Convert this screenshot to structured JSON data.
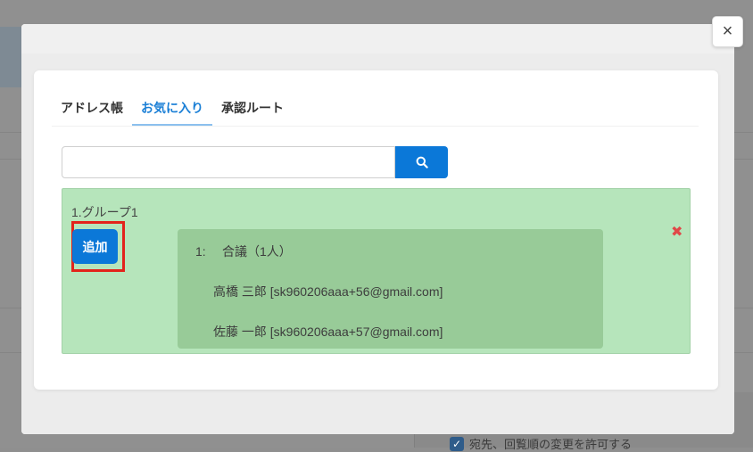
{
  "background": {
    "checkbox_label": "宛先、回覧順の変更を許可する"
  },
  "modal": {
    "close_icon": "×",
    "tabs": [
      {
        "label": "アドレス帳",
        "active": false
      },
      {
        "label": "お気に入り",
        "active": true
      },
      {
        "label": "承認ルート",
        "active": false
      }
    ],
    "search": {
      "value": "",
      "placeholder": ""
    },
    "group": {
      "title": "1.グループ1",
      "add_label": "追加",
      "remove_icon": "✖",
      "approval": {
        "number": "1:",
        "label": "合議（1人）"
      },
      "members": [
        "高橋 三郎 [sk960206aaa+56@gmail.com]",
        "佐藤 一郎 [sk960206aaa+57@gmail.com]"
      ]
    }
  },
  "colors": {
    "accent": "#0b78d8",
    "group_bg": "#b6e5bb",
    "members_bg": "#98cb98",
    "highlight": "#e3231b",
    "remove": "#e04848"
  }
}
